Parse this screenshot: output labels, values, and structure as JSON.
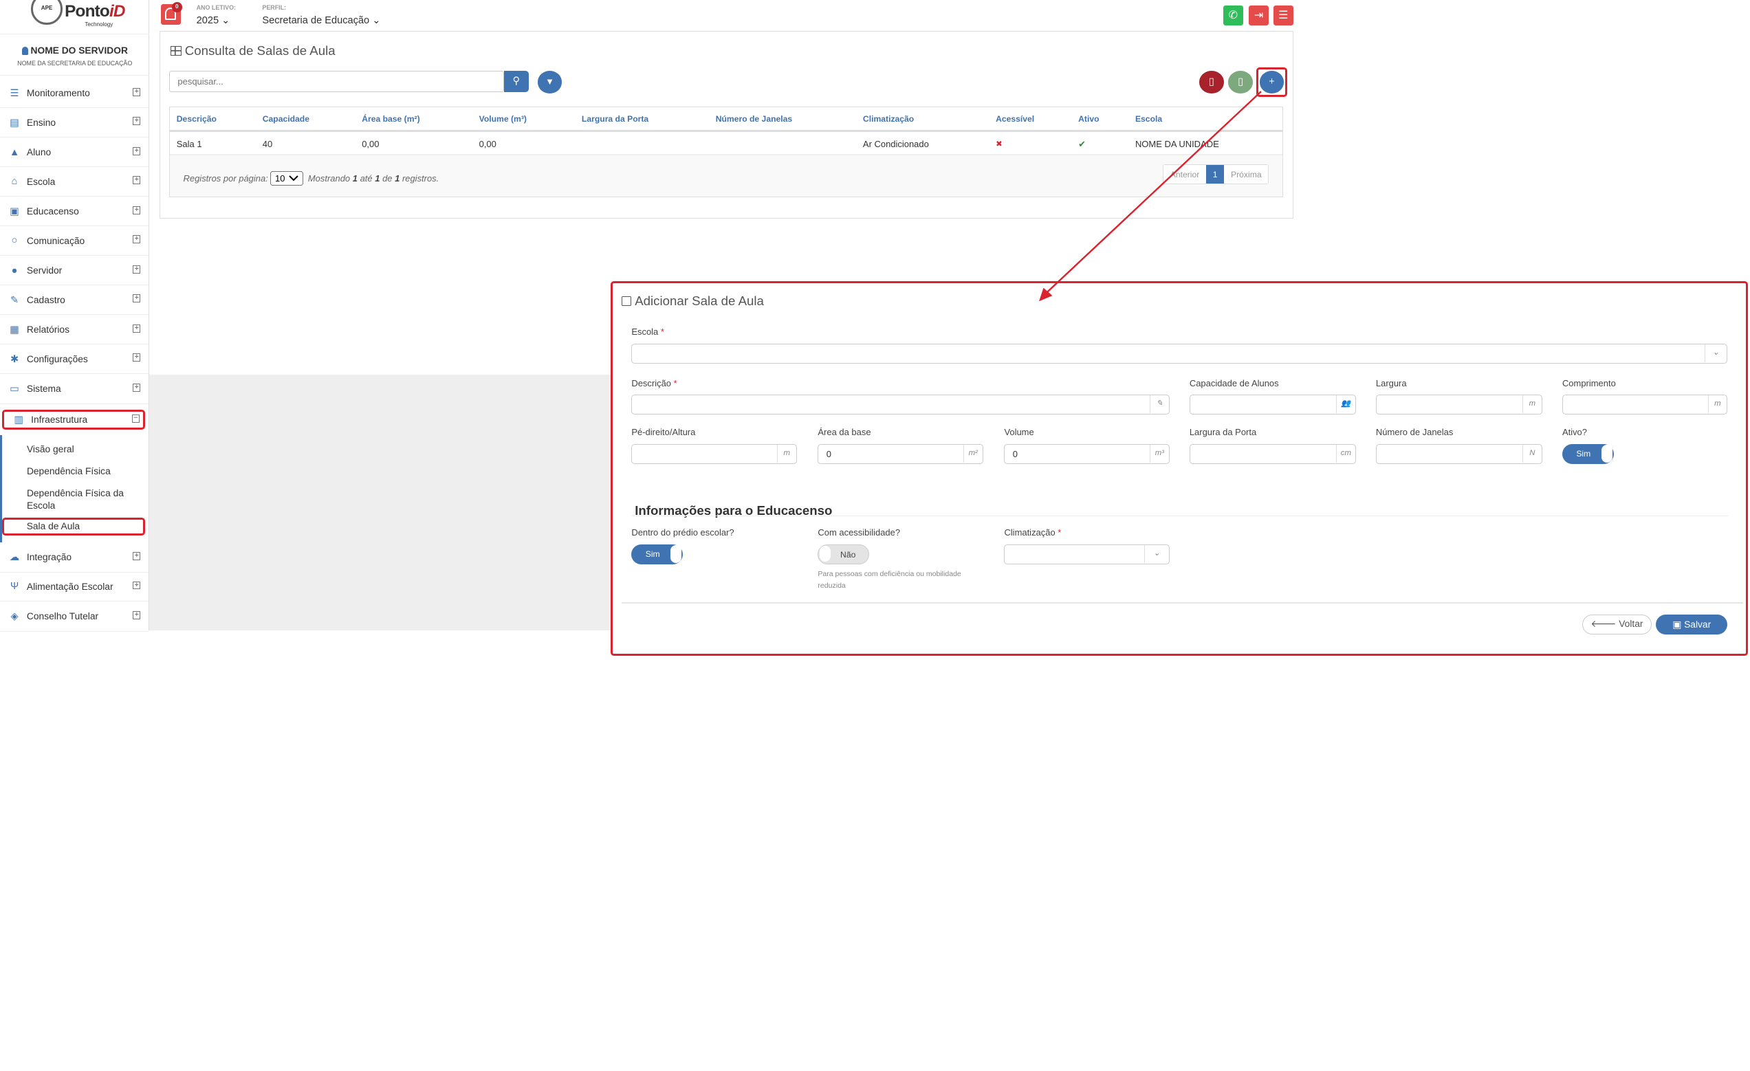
{
  "logo": {
    "seal": "APE",
    "brand_a": "Ponto",
    "brand_b": "iD",
    "sub": "Technology"
  },
  "user": {
    "name": "NOME DO SERVIDOR",
    "sub": "NOME DA SECRETARIA DE EDUCAÇÃO"
  },
  "menu": [
    {
      "label": "Monitoramento",
      "icon": "sliders-icon"
    },
    {
      "label": "Ensino",
      "icon": "book-icon"
    },
    {
      "label": "Aluno",
      "icon": "graduation-cap-icon"
    },
    {
      "label": "Escola",
      "icon": "institution-icon"
    },
    {
      "label": "Educacenso",
      "icon": "monitor-icon"
    },
    {
      "label": "Comunicação",
      "icon": "chat-icon"
    },
    {
      "label": "Servidor",
      "icon": "user-icon"
    },
    {
      "label": "Cadastro",
      "icon": "edit-icon"
    },
    {
      "label": "Relatórios",
      "icon": "report-icon"
    },
    {
      "label": "Configurações",
      "icon": "gear-icon"
    },
    {
      "label": "Sistema",
      "icon": "desktop-icon"
    },
    {
      "label": "Infraestrutura",
      "icon": "building-icon"
    },
    {
      "label": "Integração",
      "icon": "cloud-icon"
    },
    {
      "label": "Alimentação Escolar",
      "icon": "cutlery-icon"
    },
    {
      "label": "Conselho Tutelar",
      "icon": "shield-icon"
    }
  ],
  "submenu": [
    "Visão geral",
    "Dependência Física",
    "Dependência Física da Escola",
    "Sala de Aula"
  ],
  "topbar": {
    "badge": "0",
    "ano_label": "ANO LETIVO:",
    "ano_value": "2025",
    "perfil_label": "PERFIL:",
    "perfil_value": "Secretaria de Educação"
  },
  "consulta": {
    "title": "Consulta de Salas de Aula",
    "search_placeholder": "pesquisar...",
    "columns": [
      "Descrição",
      "Capacidade",
      "Área base (m²)",
      "Volume (m³)",
      "Largura da Porta",
      "Número de Janelas",
      "Climatização",
      "Acessível",
      "Ativo",
      "Escola"
    ],
    "row": {
      "descricao": "Sala 1",
      "capacidade": "40",
      "area": "0,00",
      "volume": "0,00",
      "largura": "",
      "janelas": "",
      "climatizacao": "Ar Condicionado",
      "acessivel": "✖",
      "ativo": "✔",
      "escola": "NOME DA UNIDADE"
    },
    "footer": {
      "per_page_label": "Registros por página:",
      "per_page": "10",
      "showing_a": "Mostrando",
      "from": "1",
      "until": "até",
      "to": "1",
      "of": "de",
      "total": "1",
      "records": "registros."
    },
    "pager": {
      "prev": "Anterior",
      "page": "1",
      "next": "Próxima"
    }
  },
  "modal": {
    "title": "Adicionar Sala de Aula",
    "escola_label": "Escola",
    "descricao_label": "Descrição",
    "capacidade_label": "Capacidade de Alunos",
    "largura_label": "Largura",
    "comprimento_label": "Comprimento",
    "pe_label": "Pé-direito/Altura",
    "area_label": "Área da base",
    "area_value": "0",
    "volume_label": "Volume",
    "volume_value": "0",
    "porta_label": "Largura da Porta",
    "janelas_label": "Número de Janelas",
    "ativo_label": "Ativo?",
    "ativo_value": "Sim",
    "suf_m": "m",
    "suf_m2": "m²",
    "suf_m3": "m³",
    "suf_cm": "cm",
    "suf_n": "N",
    "section": "Informações para o Educacenso",
    "dentro_label": "Dentro do prédio escolar?",
    "dentro_value": "Sim",
    "acess_label": "Com acessibilidade?",
    "acess_value": "Não",
    "acess_help": "Para pessoas com deficiência ou mobilidade reduzida",
    "clima_label": "Climatização",
    "voltar": "Voltar",
    "salvar": "Salvar"
  },
  "colors": {
    "primary": "#3f73b1",
    "highlight": "#d9232e"
  }
}
